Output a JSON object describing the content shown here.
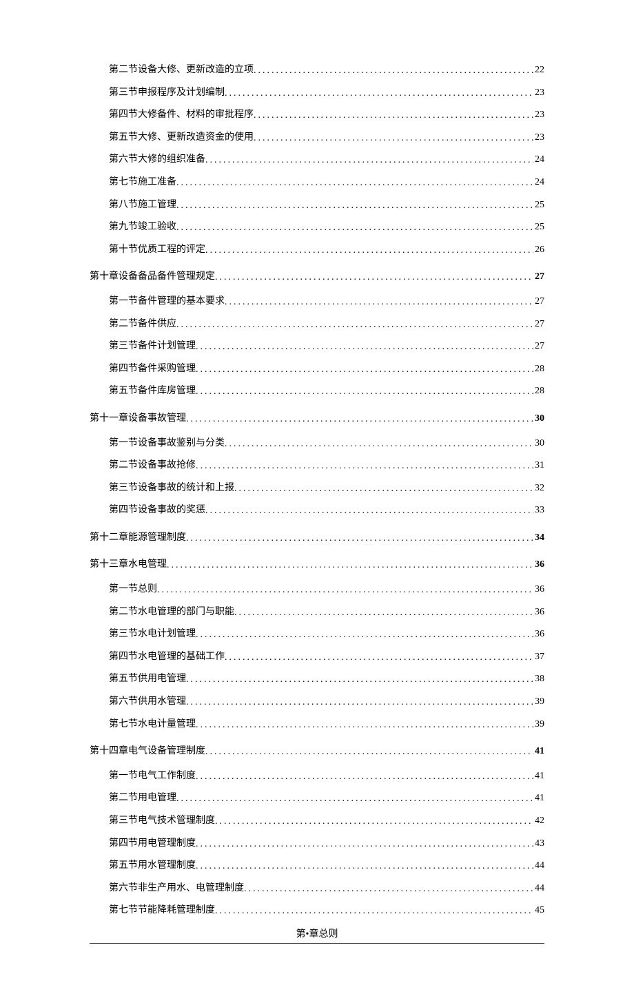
{
  "toc": [
    {
      "kind": "section",
      "label": "第二节设备大修、更新改造的立项",
      "page": "22"
    },
    {
      "kind": "section",
      "label": "第三节申报程序及计划编制",
      "page": "23"
    },
    {
      "kind": "section",
      "label": "第四节大修备件、材料的审批程序",
      "page": "23"
    },
    {
      "kind": "section",
      "label": "第五节大修、更新改造资金的使用",
      "page": "23"
    },
    {
      "kind": "section",
      "label": "第六节大修的组织准备",
      "page": "24"
    },
    {
      "kind": "section",
      "label": "第七节施工准备",
      "page": "24"
    },
    {
      "kind": "section",
      "label": "第八节施工管理",
      "page": "25"
    },
    {
      "kind": "section",
      "label": "第九节竣工验收",
      "page": "25"
    },
    {
      "kind": "section",
      "label": "第十节优质工程的评定",
      "page": "26"
    },
    {
      "kind": "chapter",
      "label": "第十章设备备品备件管理规定",
      "page": "27"
    },
    {
      "kind": "section",
      "label": "第一节备件管理的基本要求",
      "page": "27"
    },
    {
      "kind": "section",
      "label": "第二节备件供应",
      "page": "27"
    },
    {
      "kind": "section",
      "label": "第三节备件计划管理",
      "page": "27"
    },
    {
      "kind": "section",
      "label": "第四节备件采购管理",
      "page": "28"
    },
    {
      "kind": "section",
      "label": "第五节备件库房管理",
      "page": "28"
    },
    {
      "kind": "chapter",
      "label": "第十一章设备事故管理",
      "page": "30"
    },
    {
      "kind": "section",
      "label": "第一节设备事故鉴别与分类",
      "page": "30"
    },
    {
      "kind": "section",
      "label": "第二节设备事故抢修",
      "page": "31"
    },
    {
      "kind": "section",
      "label": "第三节设备事故的统计和上报",
      "page": "32"
    },
    {
      "kind": "section",
      "label": "第四节设备事故的奖惩",
      "page": "33"
    },
    {
      "kind": "chapter",
      "label": "第十二章能源管理制度",
      "page": "34"
    },
    {
      "kind": "chapter",
      "label": "第十三章水电管理",
      "page": "36"
    },
    {
      "kind": "section",
      "label": "第一节总则",
      "page": "36"
    },
    {
      "kind": "section",
      "label": "第二节水电管理的部门与职能",
      "page": "36"
    },
    {
      "kind": "section",
      "label": "第三节水电计划管理",
      "page": "36"
    },
    {
      "kind": "section",
      "label": "第四节水电管理的基础工作",
      "page": "37"
    },
    {
      "kind": "section",
      "label": "第五节供用电管理",
      "page": "38"
    },
    {
      "kind": "section",
      "label": "第六节供用水管理",
      "page": "39"
    },
    {
      "kind": "section",
      "label": "第七节水电计量管理",
      "page": "39"
    },
    {
      "kind": "chapter",
      "label": "第十四章电气设备管理制度",
      "page": "41"
    },
    {
      "kind": "section",
      "label": "第一节电气工作制度",
      "page": "41"
    },
    {
      "kind": "section",
      "label": "第二节用电管理",
      "page": "41"
    },
    {
      "kind": "section",
      "label": "第三节电气技术管理制度",
      "page": "42"
    },
    {
      "kind": "section",
      "label": "第四节用电管理制度",
      "page": "43"
    },
    {
      "kind": "section",
      "label": "第五节用水管理制度",
      "page": "44"
    },
    {
      "kind": "section",
      "label": "第六节非生产用水、电管理制度",
      "page": "44"
    },
    {
      "kind": "section",
      "label": "第七节节能降耗管理制度",
      "page": "45"
    }
  ],
  "footer": {
    "title": "第•章总则"
  }
}
